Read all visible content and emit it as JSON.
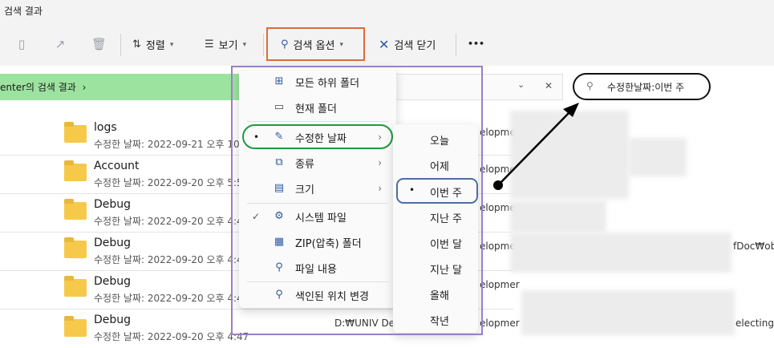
{
  "window": {
    "title": "검색 결과"
  },
  "toolbar": {
    "sort_label": "정렬",
    "view_label": "보기",
    "search_options_label": "검색 옵션",
    "close_search_label": "검색 닫기",
    "more_label": "•••"
  },
  "address": {
    "path_text": "enter의 검색 결과",
    "chevron": "›"
  },
  "search": {
    "query": "수정한날짜:이번 주"
  },
  "files": [
    {
      "name": "logs",
      "date": "수정한 날짜: 2022-09-21 오후 10",
      "path": "elopmer"
    },
    {
      "name": "Account",
      "date": "수정한 날짜: 2022-09-20 오후 5:5",
      "path": "elopmer"
    },
    {
      "name": "Debug",
      "date": "수정한 날짜: 2022-09-20 오후 4:4",
      "path": "elopmer"
    },
    {
      "name": "Debug",
      "date": "수정한 날짜: 2022-09-20 오후 4:4",
      "path": "elopmer"
    },
    {
      "name": "Debug",
      "date": "수정한 날짜: 2022-09-20 오후 4:4",
      "path": "elopmer"
    },
    {
      "name": "Debug",
      "date": "수정한 날짜: 2022-09-20 오후 4:47",
      "path": "D:₩UNIV Dev"
    }
  ],
  "right_fragments": {
    "row4": "fDoc₩obj",
    "row6": "electing₩c"
  },
  "menu": {
    "items": [
      {
        "label": "모든 하위 폴더",
        "icon": "subfolders-icon"
      },
      {
        "label": "현재 폴더",
        "icon": "folder-outline-icon"
      },
      {
        "label": "수정한 날짜",
        "icon": "calendar-edit-icon",
        "selected_marker": "•",
        "chevron": "›"
      },
      {
        "label": "종류",
        "icon": "kind-icon",
        "chevron": "›"
      },
      {
        "label": "크기",
        "icon": "size-icon",
        "chevron": "›"
      },
      {
        "label": "시스템 파일",
        "icon": "system-file-icon",
        "check": "✓"
      },
      {
        "label": "ZIP(압축) 폴더",
        "icon": "zip-folder-icon"
      },
      {
        "label": "파일 내용",
        "icon": "file-search-icon"
      },
      {
        "label": "색인된 위치 변경",
        "icon": "index-location-icon"
      }
    ]
  },
  "submenu": {
    "items": [
      "오늘",
      "어제",
      "이번 주",
      "지난 주",
      "이번 달",
      "지난 달",
      "올해",
      "작년"
    ],
    "selected": "이번 주",
    "selected_marker": "•"
  }
}
